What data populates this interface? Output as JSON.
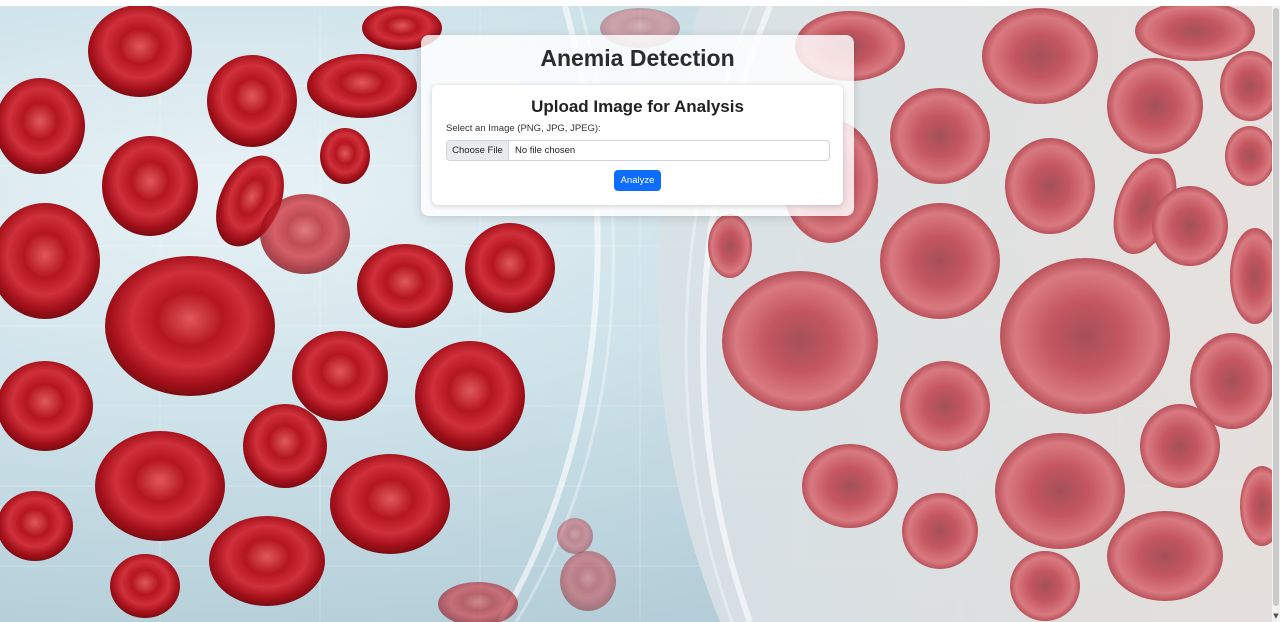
{
  "page": {
    "title": "Anemia Detection"
  },
  "upload_card": {
    "title": "Upload Image for Analysis",
    "field_label": "Select an Image (PNG, JPG, JPEG):",
    "file_button_label": "Choose File",
    "file_status": "No file chosen",
    "submit_label": "Analyze"
  },
  "background": {
    "subject": "red blood cells",
    "accent_color": "#b31b24",
    "primary_button_color": "#0d6efd"
  },
  "scrollbar": {
    "arrow_icon": "chevron-down-icon"
  }
}
